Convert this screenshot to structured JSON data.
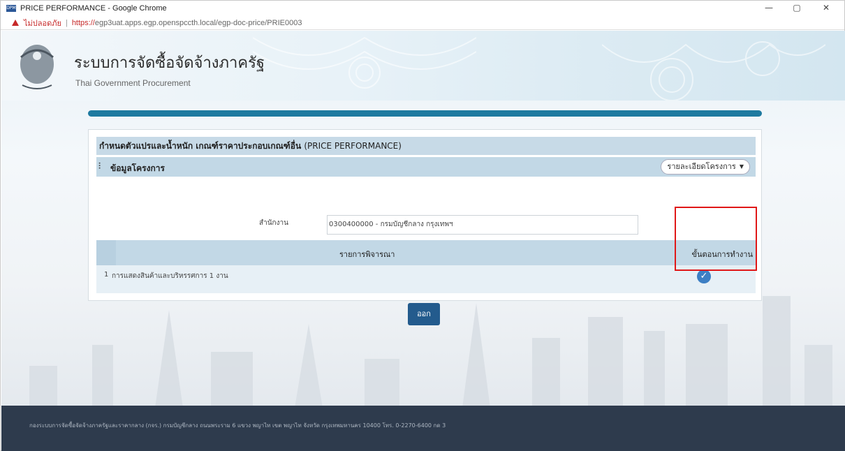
{
  "browser": {
    "app_icon": "DPM",
    "title": "PRICE PERFORMANCE - Google Chrome",
    "warning_label": "ไม่ปลอดภัย",
    "url_protocol": "https://",
    "url_rest": "egp3uat.apps.egp.openspccth.local/egp-doc-price/PRIE0003",
    "controls": {
      "minimize": "—",
      "maximize": "▢",
      "close": "✕"
    }
  },
  "header": {
    "title_th": "ระบบการจัดซื้อจัดจ้างภาครัฐ",
    "title_en": "Thai Government Procurement"
  },
  "card": {
    "heading_th": "กำหนดตัวแปรและน้ำหนัก เกณฑ์ราคาประกอบเกณฑ์อื่น",
    "heading_en": "(PRICE PERFORMANCE)",
    "section_label": "ข้อมูลโครงการ",
    "detail_button": "รายละเอียดโครงการ",
    "field_label": "สำนักงาน",
    "field_value": "0300400000 - กรมบัญชีกลาง กรุงเทพฯ",
    "table": {
      "col_main": "รายการพิจารณา",
      "col_step": "ขั้นตอนการทำงาน",
      "rows": [
        {
          "number": "1",
          "text": "การแสดงสินค้าและบริหรรศการ 1 งาน"
        }
      ]
    },
    "exit_button": "ออก"
  },
  "footer": {
    "text": "กองระบบการจัดซื้อจัดจ้างภาครัฐและราคากลาง (กจร.) กรมบัญชีกลาง ถนนพระราม 6 แขวง พญาไท เขต พญาไท จังหวัด กรุงเทพมหานคร 10400 โทร. 0-2270-6400 กด 3"
  },
  "colors": {
    "progress": "#1e7aa0",
    "section_bg": "#c2d8e6",
    "check": "#3d7fc4",
    "highlight": "#e01818",
    "exit_button": "#235b8d",
    "footer_bg": "#2e3b4d"
  }
}
